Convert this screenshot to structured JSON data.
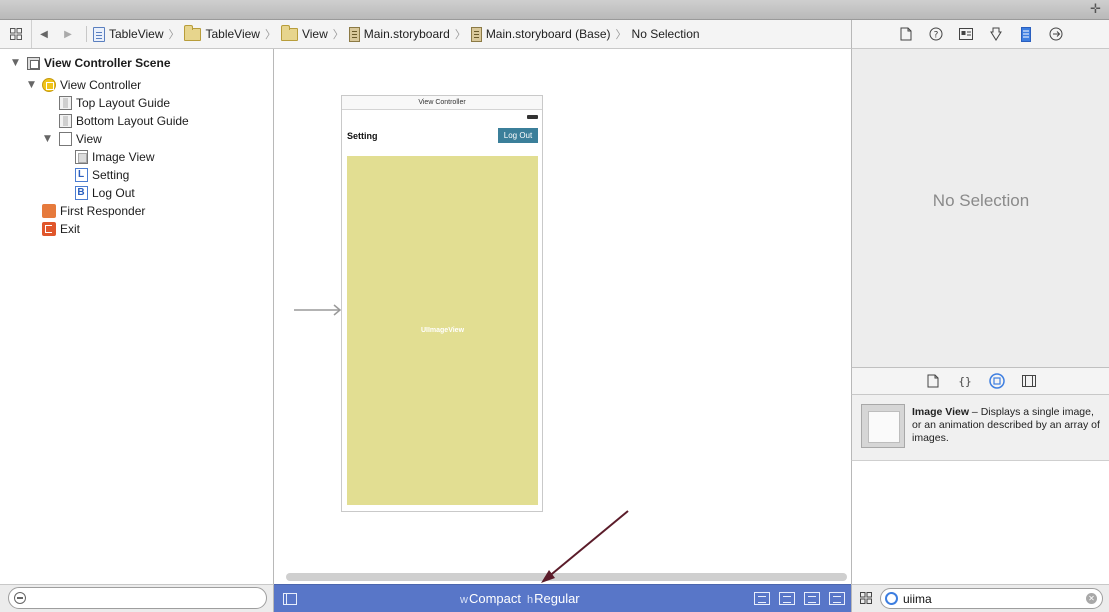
{
  "window": {
    "plus_icon": "plus-icon"
  },
  "jumpbar": {
    "breadcrumbs": [
      {
        "label": "TableView",
        "icon": "project-file-icon"
      },
      {
        "label": "TableView",
        "icon": "folder-icon"
      },
      {
        "label": "View",
        "icon": "folder-icon"
      },
      {
        "label": "Main.storyboard",
        "icon": "storyboard-icon"
      },
      {
        "label": "Main.storyboard (Base)",
        "icon": "storyboard-icon"
      },
      {
        "label": "No Selection"
      }
    ]
  },
  "outline": {
    "scene": "View Controller Scene",
    "items": [
      {
        "label": "View Controller"
      },
      {
        "label": "Top Layout Guide"
      },
      {
        "label": "Bottom Layout Guide"
      },
      {
        "label": "View"
      },
      {
        "label": "Image View"
      },
      {
        "label": "Setting",
        "badge": "L"
      },
      {
        "label": "Log Out",
        "badge": "B"
      },
      {
        "label": "First Responder"
      },
      {
        "label": "Exit"
      }
    ]
  },
  "canvas": {
    "vc_title": "View Controller",
    "setting_label": "Setting",
    "logout_button": "Log Out",
    "imageview_label": "UIImageView",
    "imageview_color": "#e2de92",
    "button_color": "#3b7f9a"
  },
  "sizeclass": {
    "w_prefix": "w",
    "w_value": "Compact",
    "h_prefix": "h",
    "h_value": "Regular",
    "bar_color": "#5876c8"
  },
  "inspector": {
    "empty_text": "No Selection"
  },
  "library": {
    "item_title": "Image View",
    "item_desc": " – Displays a single image, or an animation described by an array of images."
  },
  "filter": {
    "search_value": "uiima"
  },
  "annotation": {
    "arrow_color": "#5b1c2a"
  }
}
